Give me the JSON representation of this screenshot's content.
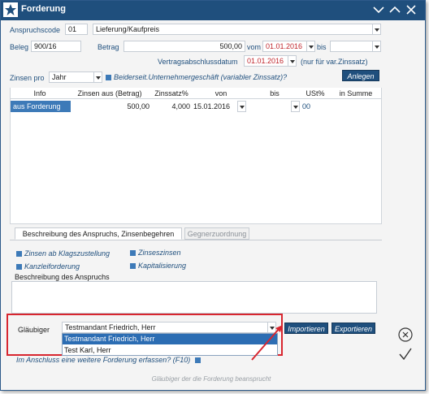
{
  "window": {
    "title": "Forderung"
  },
  "form": {
    "anspruchscode_label": "Anspruchscode",
    "anspruchscode_value": "01",
    "anspruchscode_text": "Lieferung/Kaufpreis",
    "beleg_label": "Beleg",
    "beleg_value": "900/16",
    "betrag_label": "Betrag",
    "betrag_value": "500,00",
    "vom_label": "vom",
    "vom_value": "01.01.2016",
    "bis_label": "bis",
    "bis_value": "",
    "vertrag_label": "Vertragsabschlussdatum",
    "vertrag_value": "01.01.2016",
    "vertrag_note": "(nur für var.Zinssatz)",
    "zinsen_pro_label": "Zinsen pro",
    "zinsen_pro_value": "Jahr",
    "beiderseit_label": "Beiderseit.Unternehmergeschäft (variabler Zinssatz)?",
    "anlegen_label": "Anlegen"
  },
  "grid": {
    "headers": [
      "Info",
      "Zinsen aus (Betrag)",
      "Zinssatz%",
      "von",
      "bis",
      "USt%",
      "in Summe"
    ],
    "rows": [
      {
        "info": "aus Forderung",
        "betrag": "500,00",
        "zinssatz": "4,000",
        "von": "15.01.2016",
        "bis": "",
        "ust": "00",
        "summe": ""
      }
    ]
  },
  "tabs": {
    "active": "Beschreibung des Anspruchs, Zinsenbegehren",
    "inactive": "Gegnerzuordnung"
  },
  "options": {
    "zinsen_klag": "Zinsen ab Klagszustellung",
    "zinseszinsen": "Zinseszinsen",
    "kanzleiforderung": "Kanzleiforderung",
    "kapitalisierung": "Kapitalisierung"
  },
  "beschreibung_label": "Beschreibung des Anspruchs",
  "glaeubiger": {
    "label": "Gläubiger",
    "value": "Testmandant Friedrich, Herr",
    "options": [
      "Testmandant Friedrich, Herr",
      "Test Karl, Herr"
    ],
    "importieren": "Importieren",
    "exportieren": "Exportieren"
  },
  "weitere_label": "Im Anschluss eine weitere Forderung erfassen? (F10)",
  "status_text": "Gläubiger der die Forderung beansprucht",
  "colors": {
    "titlebar": "#1f4f7d",
    "accent_red": "#d8262f",
    "selection": "#2c6db3"
  }
}
